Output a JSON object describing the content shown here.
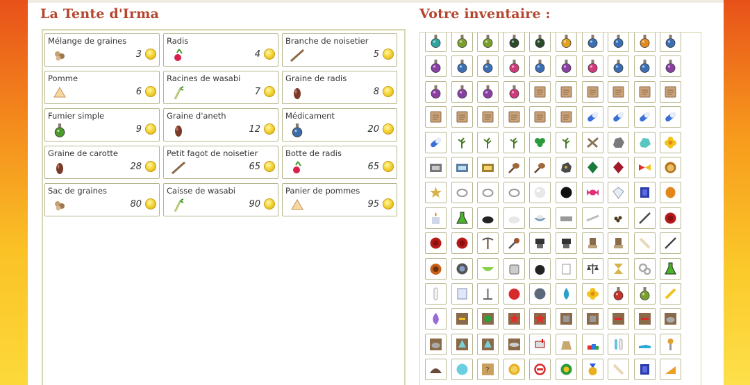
{
  "shop": {
    "title": "La Tente d'Irma",
    "items": [
      {
        "name": "Mélange de graines",
        "price": "3",
        "icon": "seed-mix-icon"
      },
      {
        "name": "Radis",
        "price": "4",
        "icon": "radish-icon"
      },
      {
        "name": "Branche de noisetier",
        "price": "5",
        "icon": "branch-icon"
      },
      {
        "name": "Pomme",
        "price": "6",
        "icon": "apple-slice-icon"
      },
      {
        "name": "Racines de wasabi",
        "price": "7",
        "icon": "wasabi-icon"
      },
      {
        "name": "Graine de radis",
        "price": "8",
        "icon": "seed-icon"
      },
      {
        "name": "Fumier simple",
        "price": "9",
        "icon": "green-potion-icon"
      },
      {
        "name": "Graine d'aneth",
        "price": "12",
        "icon": "seed-icon"
      },
      {
        "name": "Médicament",
        "price": "20",
        "icon": "blue-potion-icon"
      },
      {
        "name": "Graine de carotte",
        "price": "28",
        "icon": "seed-icon"
      },
      {
        "name": "Petit fagot de noisetier",
        "price": "65",
        "icon": "branch-icon"
      },
      {
        "name": "Botte de radis",
        "price": "65",
        "icon": "radish-icon"
      },
      {
        "name": "Sac de graines",
        "price": "80",
        "icon": "seed-mix-icon"
      },
      {
        "name": "Caisse de wasabi",
        "price": "90",
        "icon": "wasabi-icon"
      },
      {
        "name": "Panier de pommes",
        "price": "95",
        "icon": "apple-slice-icon"
      }
    ]
  },
  "inventory": {
    "title": "Votre inventaire :",
    "rows": [
      [
        "potion-teal",
        "potion-green",
        "potion-green",
        "potion-dark",
        "potion-dark",
        "potion-rainbow",
        "potion-blue",
        "potion-blue",
        "potion-orange",
        "potion-blue"
      ],
      [
        "potion-purple",
        "potion-blue",
        "potion-blue",
        "potion-pink",
        "potion-blue",
        "potion-purple",
        "potion-pink",
        "potion-blue",
        "potion-blue",
        "potion-purple"
      ],
      [
        "potion-purple",
        "potion-purple",
        "potion-purple",
        "potion-pink",
        "scroll",
        "scroll",
        "scroll",
        "scroll",
        "scroll",
        "scroll"
      ],
      [
        "scroll",
        "scroll",
        "scroll",
        "scroll",
        "scroll",
        "scroll",
        "pill",
        "pill",
        "pill",
        "pill"
      ],
      [
        "pill",
        "herb",
        "herb",
        "herb",
        "clover",
        "herb",
        "sticks",
        "stone",
        "crystal-teal",
        "flower-yellow"
      ],
      [
        "tray-grey",
        "tray-blue",
        "tray-gold",
        "spoon",
        "spoon",
        "ore",
        "gem-green",
        "gem-red",
        "bow",
        "lion"
      ],
      [
        "star",
        "ring",
        "ring",
        "ring",
        "pearl",
        "black-ball",
        "candy",
        "diamond",
        "gem-blue",
        "gem-orange"
      ],
      [
        "candle",
        "flask-green",
        "powder-black",
        "powder-white",
        "bowl-blue",
        "bar-grey",
        "stick",
        "pebbles",
        "pen",
        "seal-red"
      ],
      [
        "seal-red",
        "seal-red",
        "pickaxe",
        "tool",
        "stamp",
        "stamp",
        "mortar",
        "mortar",
        "bone",
        "pen"
      ],
      [
        "pot-orange",
        "bowl-grey",
        "bowl-green",
        "jar",
        "cauldron",
        "measuring-cup",
        "scales",
        "hourglass",
        "gears",
        "flask-green"
      ],
      [
        "test-tube",
        "notepad",
        "stand",
        "tomato",
        "ball-grey",
        "drop",
        "flower-yellow",
        "potion-red",
        "potion-green",
        "pencil"
      ],
      [
        "flame-purple",
        "box-note",
        "box-green",
        "box-explode",
        "box-explode",
        "box-grey",
        "box-grey",
        "box-red",
        "box-red",
        "box-pot"
      ],
      [
        "box-pot",
        "box-crystal",
        "box-crystal",
        "box-ufo",
        "mailbox",
        "sack",
        "toys",
        "test-tubes",
        "shoe",
        "gear-stick"
      ],
      [
        "hedgehog",
        "flower-blue",
        "box-question",
        "coin",
        "no-sign",
        "badge-green",
        "medal",
        "bone",
        "gem-blue",
        "cheese"
      ]
    ]
  }
}
